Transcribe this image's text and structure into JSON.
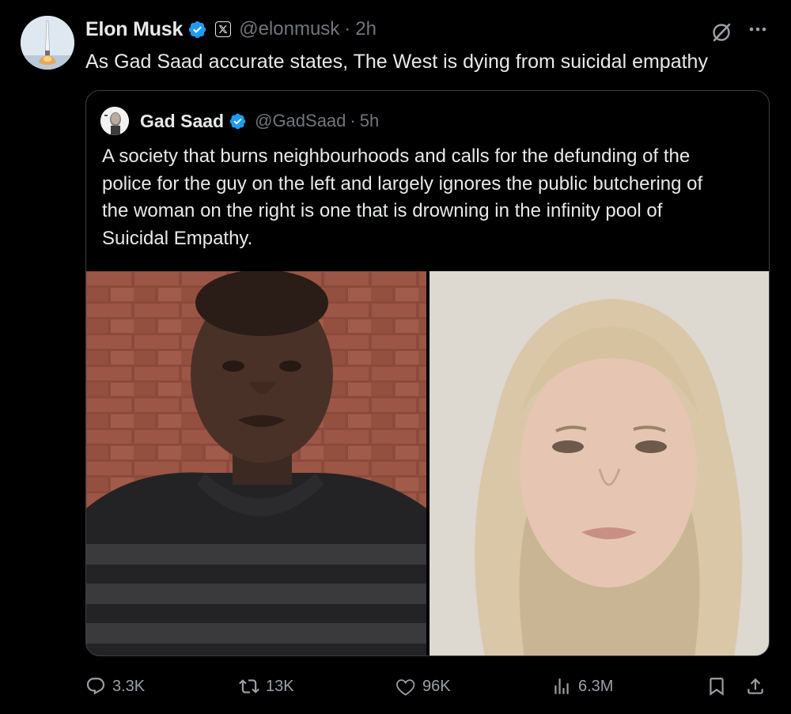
{
  "author": {
    "name": "Elon Musk",
    "handle": "@elonmusk",
    "separator": "·",
    "time": "2h",
    "text": "As Gad Saad accurate states, The West is dying from suicidal empathy"
  },
  "quoted": {
    "name": "Gad Saad",
    "handle": "@GadSaad",
    "separator": "·",
    "time": "5h",
    "text_lines": [
      "A society that burns neighbourhoods and calls for the defunding of the",
      "police for the guy on the left and largely ignores the public butchering of",
      "the woman on the right is one that is drowning in the infinity pool of",
      "Suicidal Empathy."
    ]
  },
  "actions": {
    "replies": "3.3K",
    "reposts": "13K",
    "likes": "96K",
    "views": "6.3M"
  },
  "icons": {
    "verified": "verified-badge-icon",
    "x_badge": "x-logo-icon",
    "grok": "grok-icon",
    "more": "more-icon",
    "reply": "reply-icon",
    "repost": "repost-icon",
    "like": "heart-icon",
    "views": "views-icon",
    "bookmark": "bookmark-icon",
    "share": "share-icon"
  },
  "colors": {
    "background": "#000000",
    "text": "#e7e9ea",
    "muted": "#71767b",
    "verified": "#1d9bf0",
    "border": "#3a3f44"
  }
}
